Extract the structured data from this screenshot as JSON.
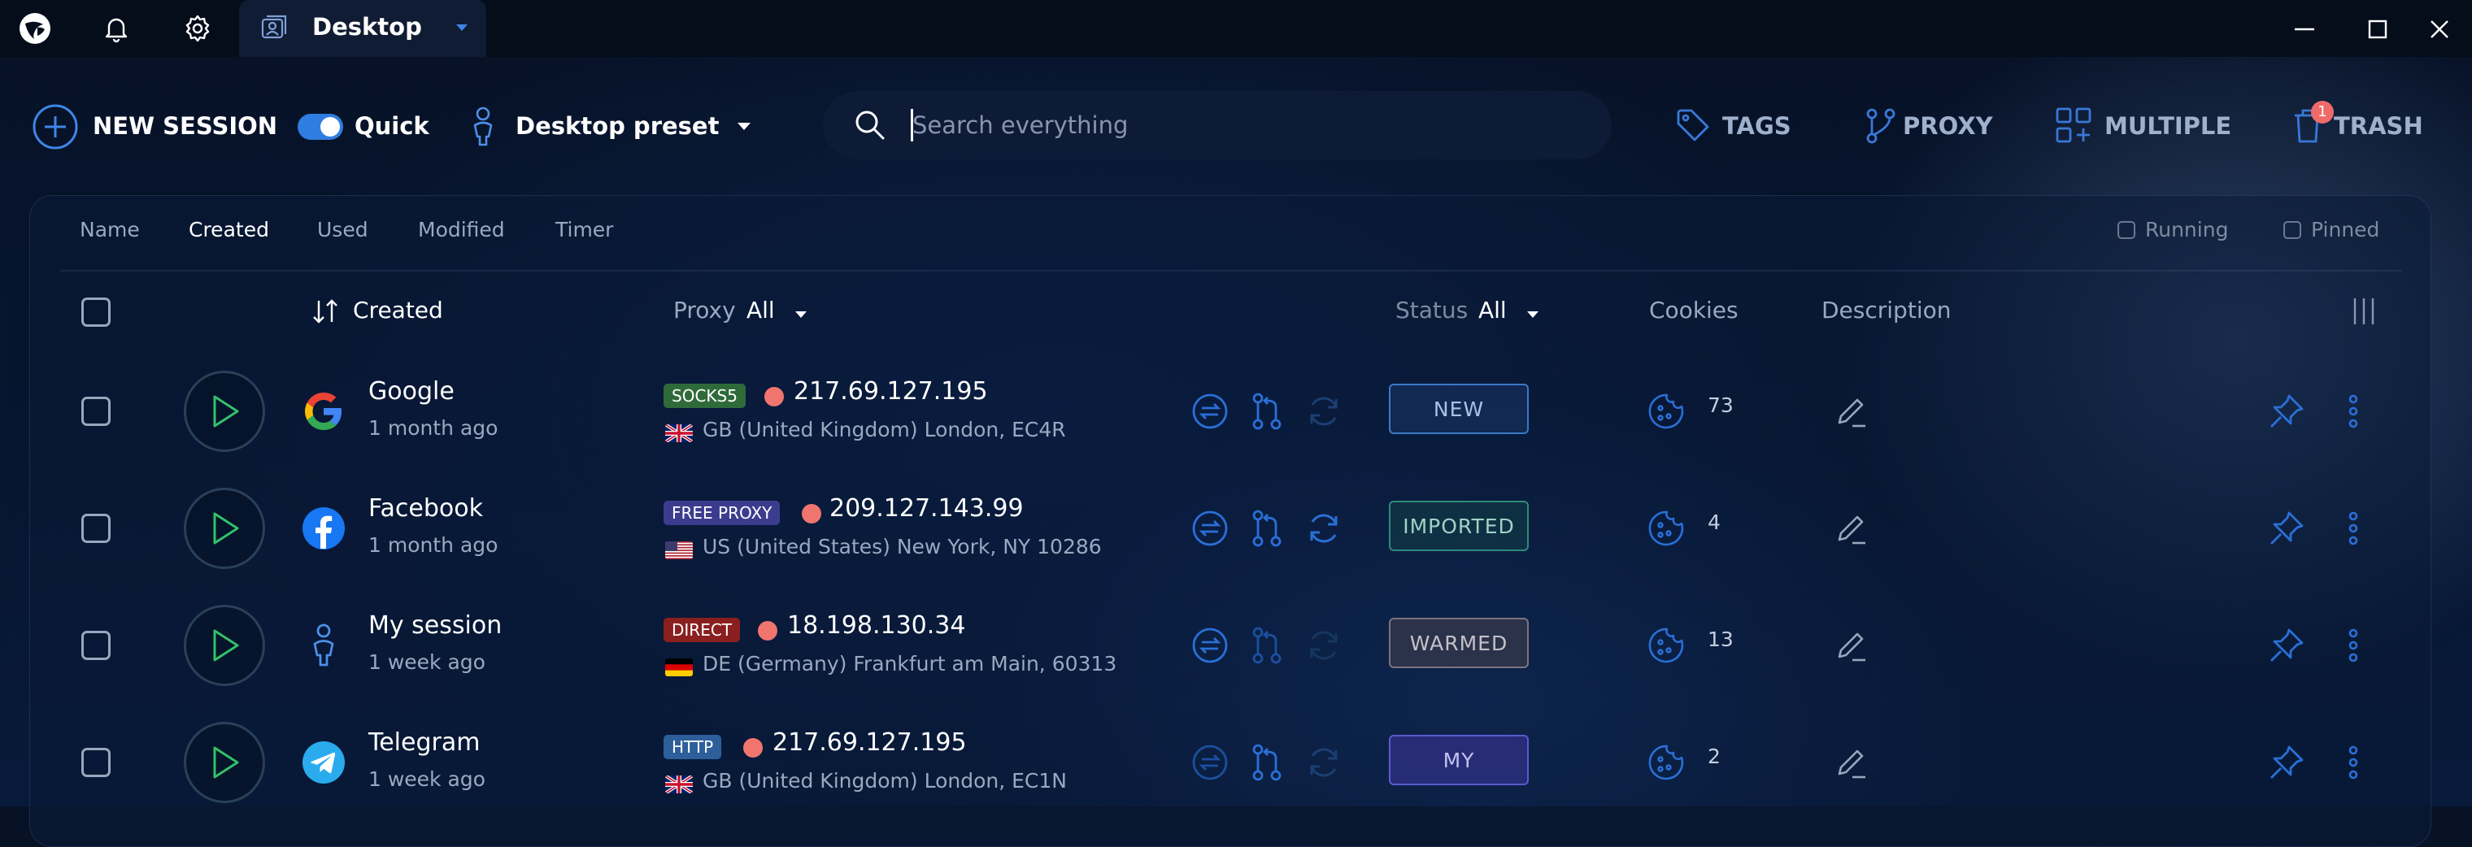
{
  "titlebar": {
    "tab_title": "Desktop"
  },
  "toolbar": {
    "new_session_label": "NEW SESSION",
    "quick_label": "Quick",
    "quick_enabled": true,
    "preset_label": "Desktop preset",
    "search_placeholder": "Search everything",
    "tags_label": "TAGS",
    "proxy_label": "PROXY",
    "multiple_label": "MULTIPLE",
    "trash_label": "TRASH",
    "trash_count": "1"
  },
  "sort_tabs": [
    {
      "label": "Name",
      "active": false
    },
    {
      "label": "Created",
      "active": true
    },
    {
      "label": "Used",
      "active": false
    },
    {
      "label": "Modified",
      "active": false
    },
    {
      "label": "Timer",
      "active": false
    }
  ],
  "filters": {
    "running_label": "Running",
    "pinned_label": "Pinned"
  },
  "table_header": {
    "created_label": "Created",
    "proxy_label": "Proxy",
    "proxy_filter": "All",
    "status_label": "Status",
    "status_filter": "All",
    "cookies_label": "Cookies",
    "description_label": "Description"
  },
  "rows": [
    {
      "name": "Google",
      "time": "1 month ago",
      "icon": "google-logo-icon",
      "proxy_type": "SOCKS5",
      "proxy_color": "#2f6b3a",
      "ip": "217.69.127.195",
      "flag": "uk-flag-icon",
      "location": "GB (United Kingdom) London, EC4R",
      "status": "NEW",
      "status_color": "#3a78c8",
      "cookies": "73"
    },
    {
      "name": "Facebook",
      "time": "1 month ago",
      "icon": "facebook-logo-icon",
      "proxy_type": "FREE PROXY",
      "proxy_color": "#3c3c8f",
      "ip": "209.127.143.99",
      "flag": "us-flag-icon",
      "location": "US (United States) New York, NY 10286",
      "status": "IMPORTED",
      "status_color": "#2f8a7a",
      "cookies": "4"
    },
    {
      "name": "My session",
      "time": "1 week ago",
      "icon": "person-icon",
      "proxy_type": "DIRECT",
      "proxy_color": "#8a1f1f",
      "ip": "18.198.130.34",
      "flag": "de-flag-icon",
      "location": "DE (Germany) Frankfurt am Main, 60313",
      "status": "WARMED",
      "status_color": "#7a7480",
      "cookies": "13"
    },
    {
      "name": "Telegram",
      "time": "1 week ago",
      "icon": "telegram-logo-icon",
      "proxy_type": "HTTP",
      "proxy_color": "#2d5f9a",
      "ip": "217.69.127.195",
      "flag": "uk-flag-icon",
      "location": "GB (United Kingdom) London, EC1N",
      "status": "MY",
      "status_color": "#5a5ad0",
      "cookies": "2"
    }
  ],
  "colors": {
    "accent": "#2f7de0",
    "icon_blue": "#2a6fd6",
    "play_green": "#34c06a"
  }
}
